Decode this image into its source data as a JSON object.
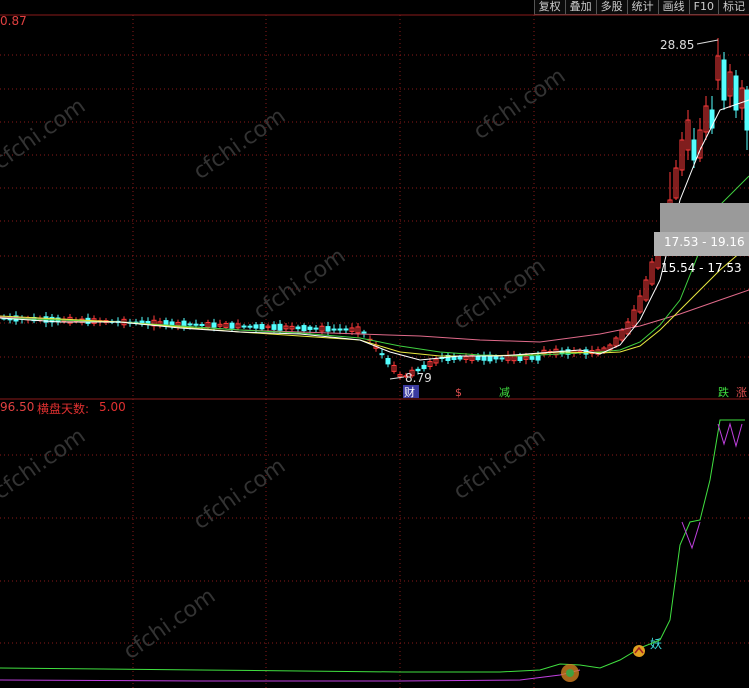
{
  "toolbar": {
    "buttons": [
      "复权",
      "叠加",
      "多股",
      "统计",
      "画线",
      "F10",
      "标记"
    ]
  },
  "upper_panel": {
    "axis_value": "0.87",
    "high_label": "28.85",
    "low_label": "8.79",
    "band1_label": "17.53 - 19.16",
    "band2_label": "15.54 - 17.53",
    "event_markers": [
      "财",
      "$",
      "减",
      "跌",
      "涨"
    ]
  },
  "lower_panel": {
    "axis_value": "96.50",
    "indicator_label": "横盘天数:",
    "indicator_value": "5.00",
    "signal_label": "妖"
  },
  "watermark": "cfchi.com",
  "colors": {
    "background": "#000000",
    "grid": "#8a1a1a",
    "up_candle": "#ff3b3b",
    "down_candle": "#54ffff",
    "ma_white": "#ffffff",
    "ma_yellow": "#e8e840",
    "ma_green": "#40d040",
    "ma_pink": "#e06a8a",
    "indicator_green": "#40e040",
    "indicator_purple": "#c040e0"
  }
}
